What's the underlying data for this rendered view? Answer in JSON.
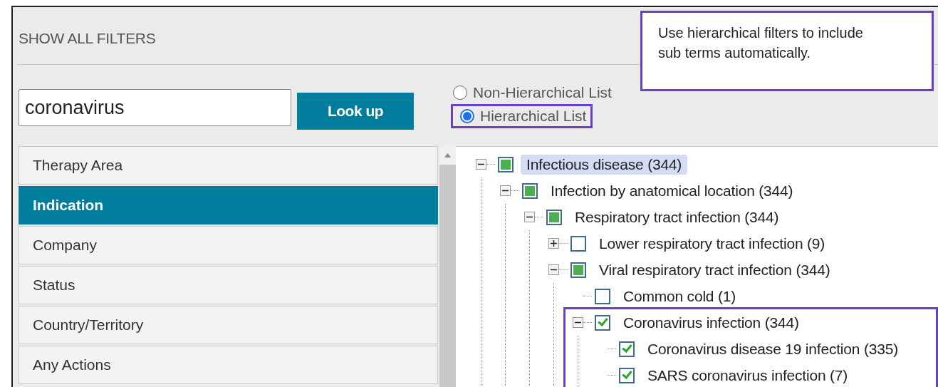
{
  "header": {
    "title": "SHOW ALL FILTERS"
  },
  "search": {
    "value": "coronavirus",
    "button": "Look up"
  },
  "categories": [
    {
      "label": "Therapy Area",
      "selected": false
    },
    {
      "label": "Indication",
      "selected": true
    },
    {
      "label": "Company",
      "selected": false
    },
    {
      "label": "Status",
      "selected": false
    },
    {
      "label": "Country/Territory",
      "selected": false
    },
    {
      "label": "Any Actions",
      "selected": false
    }
  ],
  "list_modes": [
    {
      "label": "Non-Hierarchical List",
      "selected": false,
      "annotated": false
    },
    {
      "label": "Hierarchical List",
      "selected": true,
      "annotated": true
    }
  ],
  "callout": {
    "text": "Use hierarchical filters to include sub terms automatically."
  },
  "tree": [
    {
      "label": "Infectious disease (344)",
      "checked": false,
      "partial": true,
      "expanded": true,
      "selected": true,
      "children": [
        {
          "label": "Infection by anatomical location (344)",
          "checked": false,
          "partial": true,
          "expanded": true,
          "selected": false,
          "children": [
            {
              "label": "Respiratory tract infection (344)",
              "checked": false,
              "partial": true,
              "expanded": true,
              "selected": false,
              "children": [
                {
                  "label": "Lower respiratory tract infection (9)",
                  "checked": false,
                  "partial": false,
                  "expanded": false,
                  "selected": false
                },
                {
                  "label": "Viral respiratory tract infection (344)",
                  "checked": false,
                  "partial": true,
                  "expanded": true,
                  "selected": false,
                  "children": [
                    {
                      "label": "Common cold (1)",
                      "checked": false,
                      "partial": false,
                      "selected": false
                    },
                    {
                      "label": "Coronavirus infection (344)",
                      "checked": true,
                      "partial": false,
                      "expanded": true,
                      "selected": false,
                      "annotated": true,
                      "children": [
                        {
                          "label": "Coronavirus disease 19 infection (335)",
                          "checked": true,
                          "partial": false,
                          "selected": false
                        },
                        {
                          "label": "SARS coronavirus infection (7)",
                          "checked": true,
                          "partial": false,
                          "selected": false
                        }
                      ]
                    }
                  ]
                }
              ]
            }
          ]
        }
      ]
    }
  ]
}
